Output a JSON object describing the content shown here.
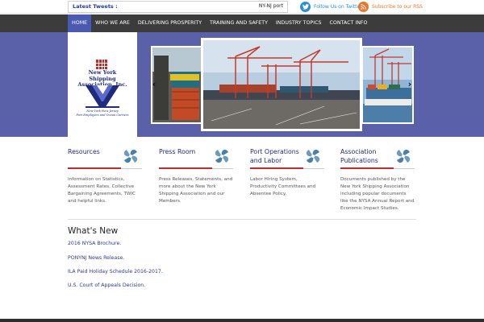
{
  "topbar": {
    "tweets_label": "Latest Tweets :",
    "tweets_text": "NY-NJ port",
    "twitter_label": "Follow Us on Twitter",
    "rss_label": "Subscribe to our RSS"
  },
  "nav": {
    "items": [
      {
        "label": "HOME",
        "active": true
      },
      {
        "label": "WHO WE ARE",
        "active": false
      },
      {
        "label": "DELIVERING PROSPERITY",
        "active": false
      },
      {
        "label": "TRAINING AND SAFETY",
        "active": false
      },
      {
        "label": "INDUSTRY TOPICS",
        "active": false
      },
      {
        "label": "CONTACT INFO",
        "active": false
      }
    ]
  },
  "logo": {
    "name_line1": "New York Shipping",
    "name_line2": "Association, Inc.",
    "tag_line1": "New York-New Jersey",
    "tag_line2": "Port Employers and Ocean Carriers"
  },
  "features": [
    {
      "title": "Resources",
      "desc": "Information on Statistics, Assessment Rates, Collective Bargaining Agreements, TWIC and helpful links."
    },
    {
      "title": "Press Room",
      "desc": "Press Releases, Statements, and more about the New York Shipping Association and our Members."
    },
    {
      "title": "Port Operations and Labor",
      "desc": "Labor Hiring System, Productivity Committees and Absentee Policy."
    },
    {
      "title": "Association Publications",
      "desc": "Documents published by the New York Shipping Association including popular documents like the NYSA Annual Report and Economic Impact Studies."
    }
  ],
  "news": {
    "title": "What's New",
    "links": [
      "2016 NYSA Brochure.",
      "PONYNJ News Release.",
      "ILA Paid Holiday Schedule 2016-2017.",
      "U.S. Court of Appeals Decision."
    ]
  },
  "colors": {
    "brand_blue": "#1f2a7a",
    "hero_bg": "#5a61a8",
    "nav_bg": "#3c3c3c",
    "accent_red": "#c42a2a",
    "twitter": "#2a8fd6",
    "rss": "#e8772e"
  },
  "icons": {
    "twitter": "twitter-icon",
    "rss": "rss-icon",
    "feature": "propeller-icon",
    "prev": "chevron-left-icon",
    "next": "chevron-right-icon"
  }
}
